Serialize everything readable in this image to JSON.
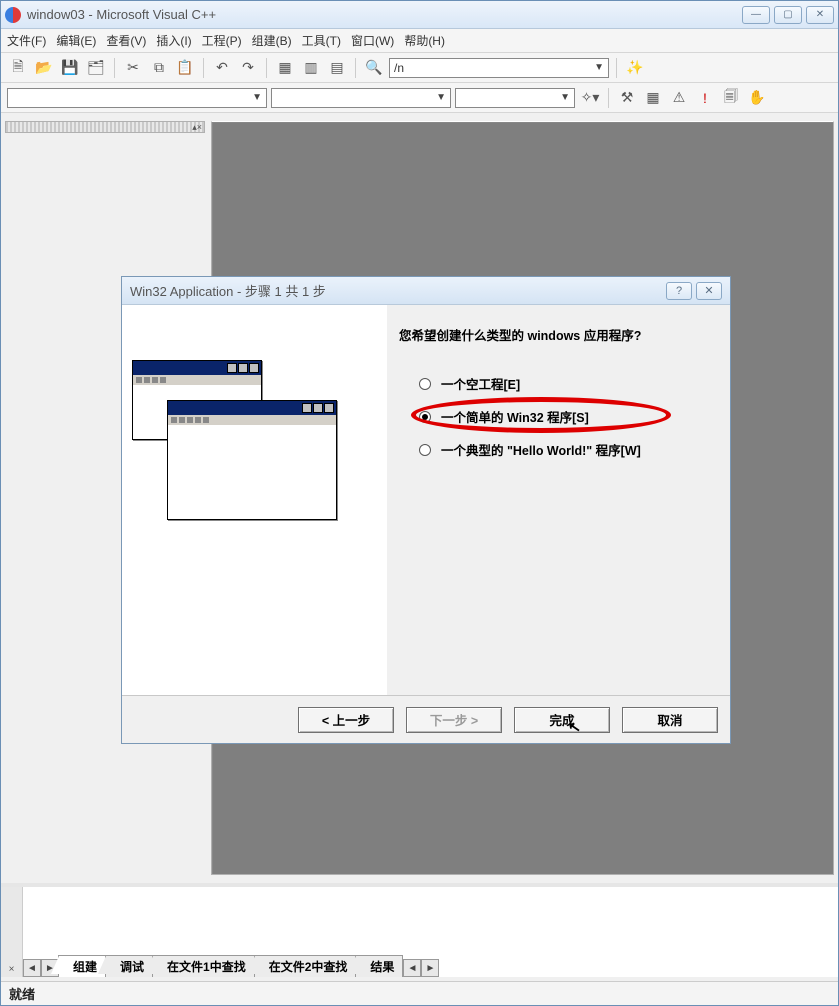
{
  "window": {
    "title": "window03 - Microsoft Visual C++"
  },
  "menu": {
    "items": [
      "文件(F)",
      "编辑(E)",
      "查看(V)",
      "插入(I)",
      "工程(P)",
      "组建(B)",
      "工具(T)",
      "窗口(W)",
      "帮助(H)"
    ]
  },
  "toolbar": {
    "find_value": "/n"
  },
  "wizard": {
    "title": "Win32 Application - 步骤 1 共 1 步",
    "question": "您希望创建什么类型的 windows 应用程序?",
    "options": {
      "opt1": "一个空工程[E]",
      "opt2": "一个简单的 Win32 程序[S]",
      "opt3": "一个典型的 \"Hello World!\" 程序[W]"
    },
    "buttons": {
      "back": "< 上一步",
      "next": "下一步 >",
      "finish": "完成",
      "cancel": "取消"
    }
  },
  "output_tabs": {
    "t1": "组建",
    "t2": "调试",
    "t3": "在文件1中查找",
    "t4": "在文件2中查找",
    "t5": "结果"
  },
  "status": {
    "text": "就绪"
  }
}
